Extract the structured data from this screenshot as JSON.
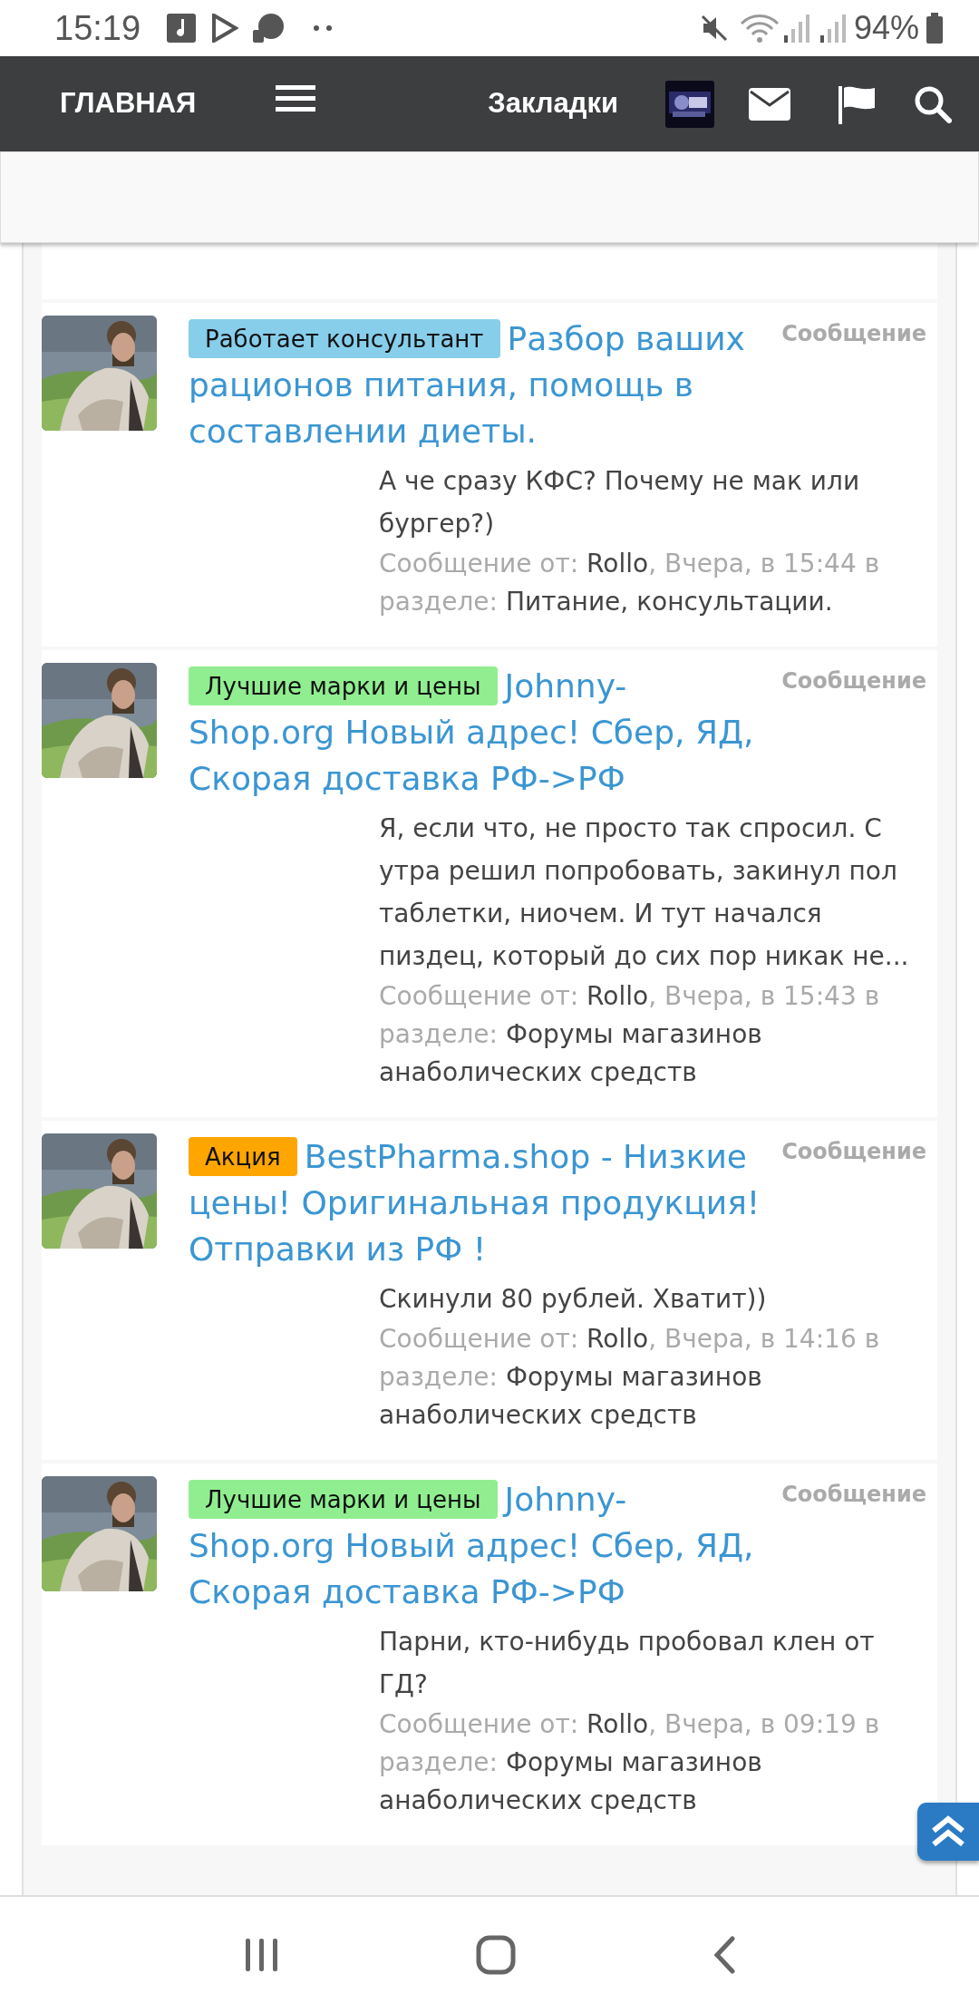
{
  "status_bar": {
    "time": "15:19",
    "battery": "94%"
  },
  "navbar": {
    "home_label": "ГЛАВНАЯ",
    "bookmarks_label": "Закладки"
  },
  "results": [
    {
      "prefix": {
        "label": "Работает консультант",
        "color": "#87ceeb"
      },
      "title": "Разбор ваших рационов питания, помощь в составлении диеты.",
      "type_label": "Сообщение",
      "snippet": "А че сразу КФС? Почему не мак или бургер?)",
      "meta": {
        "by_label": "Сообщение от:",
        "author": "Rollo",
        "when": ", Вчера, в 15:44 в разделе:",
        "forum": "Питание, консультации."
      }
    },
    {
      "prefix": {
        "label": "Лучшие марки и цены",
        "color": "#90ee90"
      },
      "title": "Johnny-Shop.org Новый адрес! Сбер, ЯД, Скорая доставка РФ->РФ",
      "type_label": "Сообщение",
      "snippet": "Я, если что, не просто так спросил. С утра решил попробовать, закинул пол таблетки, ниочем. И тут начался пиздец, который до сих пор никак не...",
      "meta": {
        "by_label": "Сообщение от:",
        "author": "Rollo",
        "when": ", Вчера, в 15:43 в разделе:",
        "forum": "Форумы магазинов анаболических средств"
      }
    },
    {
      "prefix": {
        "label": "Акция",
        "color": "#ffa500"
      },
      "title": "BestPharma.shop - Низкие цены! Оригинальная продукция! Отправки из РФ !",
      "type_label": "Сообщение",
      "snippet": "Скинули 80 рублей. Хватит))",
      "meta": {
        "by_label": "Сообщение от:",
        "author": "Rollo",
        "when": ", Вчера, в 14:16 в разделе:",
        "forum": "Форумы магазинов анаболических средств"
      }
    },
    {
      "prefix": {
        "label": "Лучшие марки и цены",
        "color": "#90ee90"
      },
      "title": "Johnny-Shop.org Новый адрес! Сбер, ЯД, Скорая доставка РФ->РФ",
      "type_label": "Сообщение",
      "snippet": "Парни, кто-нибудь пробовал клен от ГД?",
      "meta": {
        "by_label": "Сообщение от:",
        "author": "Rollo",
        "when": ", Вчера, в 09:19 в разделе:",
        "forum": "Форумы магазинов анаболических средств"
      }
    }
  ]
}
